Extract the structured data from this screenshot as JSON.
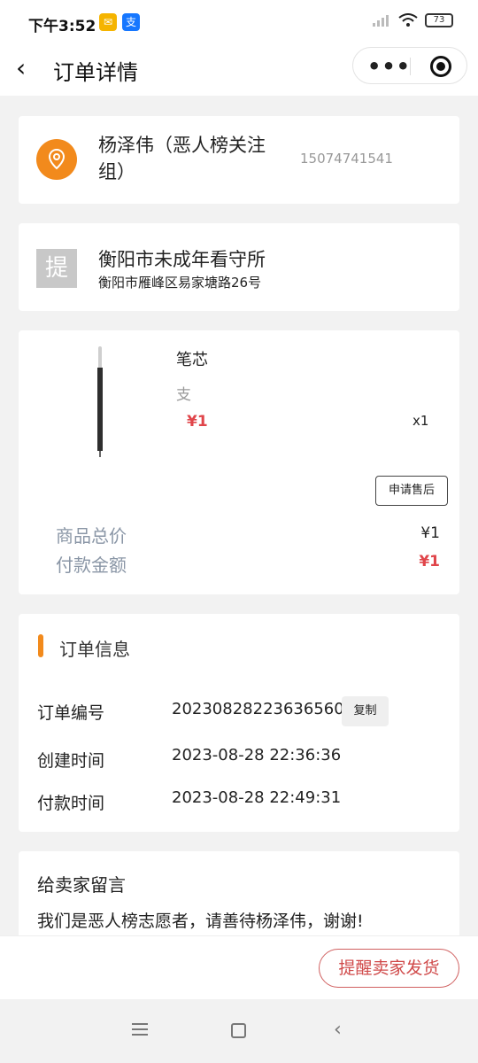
{
  "status_bar": {
    "time": "下午3:52",
    "battery": "73"
  },
  "navbar": {
    "back_icon": "‹",
    "title": "订单详情",
    "more_icon": "•••"
  },
  "address": {
    "name": "杨泽伟（恶人榜关注组）",
    "phone": "15074741541"
  },
  "pickup": {
    "badge": "提",
    "name": "衡阳市未成年看守所",
    "address": "衡阳市雁峰区易家塘路26号"
  },
  "goods": {
    "name": "笔芯",
    "spec": "支",
    "price": "¥1",
    "qty": "x1",
    "after_sale_label": "申请售后"
  },
  "summary": {
    "total_label": "商品总价",
    "total_value": "¥1",
    "pay_label": "付款金额",
    "pay_value": "¥1"
  },
  "order_info": {
    "title": "订单信息",
    "copy_label": "复制",
    "rows": [
      {
        "label": "订单编号",
        "value": "20230828223636560"
      },
      {
        "label": "创建时间",
        "value": "2023-08-28 22:36:36"
      },
      {
        "label": "付款时间",
        "value": "2023-08-28 22:49:31"
      }
    ]
  },
  "message": {
    "title": "给卖家留言",
    "text": "我们是恶人榜志愿者，请善待杨泽伟，谢谢!"
  },
  "bottom": {
    "remind_label": "提醒卖家发货"
  },
  "colors": {
    "accent": "#f28a1c",
    "price_red": "#e0454a",
    "muted_label": "#8a96a6"
  },
  "icons": [
    "location-pin-icon",
    "back-chevron-icon",
    "more-dots-icon",
    "close-miniprogram-icon",
    "menu-icon",
    "home-icon",
    "back-icon"
  ]
}
